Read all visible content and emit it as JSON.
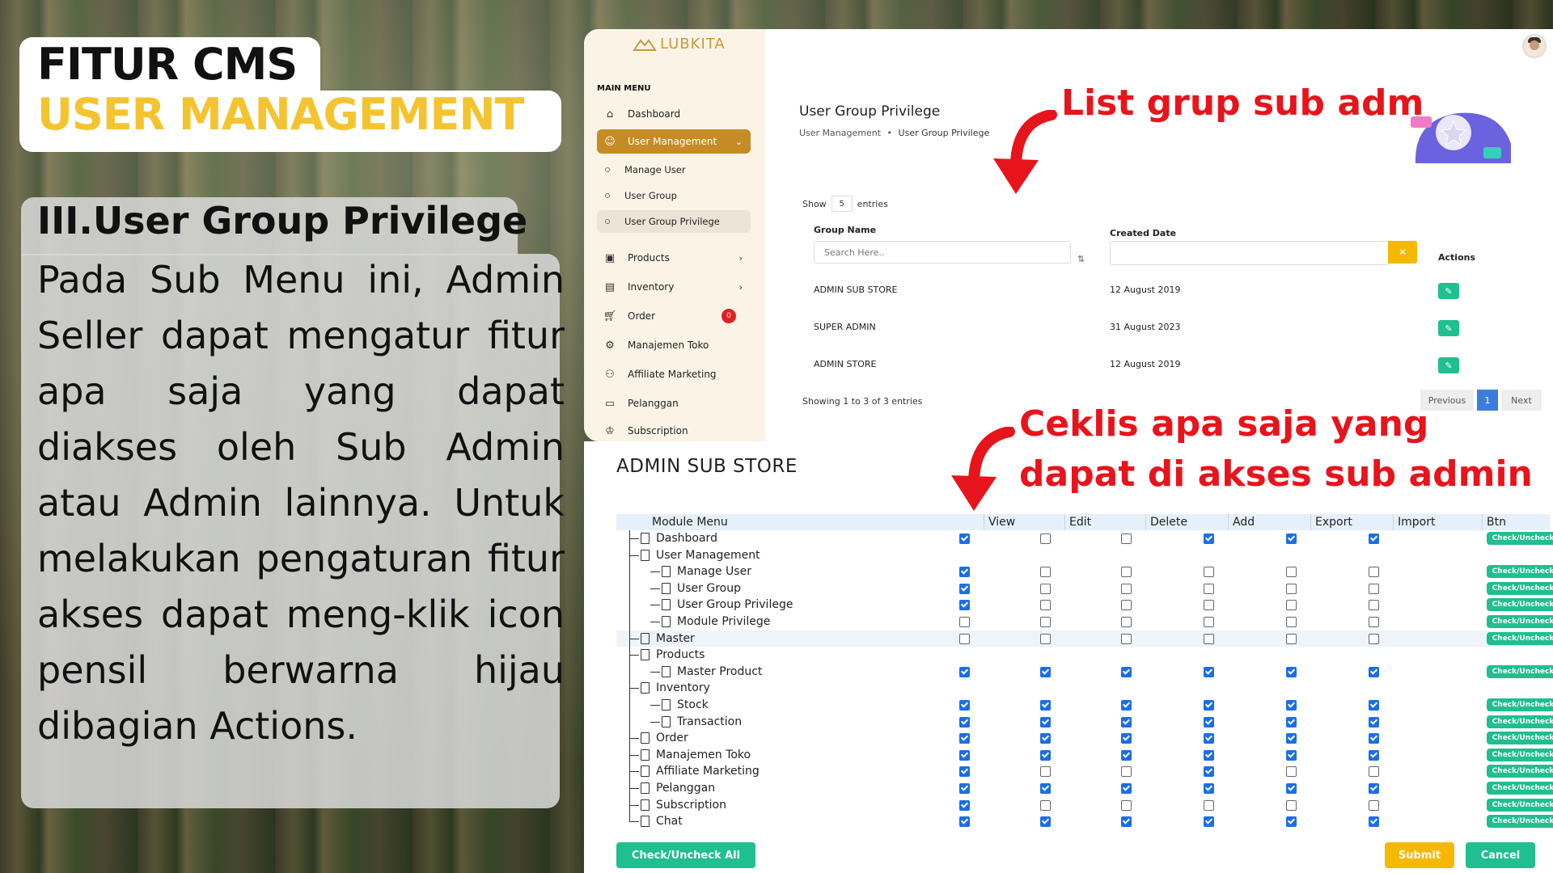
{
  "slide": {
    "title_line1": "FITUR CMS",
    "title_line2": "USER MANAGEMENT",
    "section_title": "III.User Group Privilege",
    "description": "Pada Sub Menu ini, Admin Seller dapat mengatur fitur apa saja yang dapat diakses oleh Sub Admin atau Admin lainnya. Untuk melakukan pengaturan fitur akses dapat meng-klik icon pensil berwarna hijau dibagian Actions."
  },
  "annotations": {
    "top": "List grup sub adm",
    "bottom_line1": "Ceklis apa saja yang",
    "bottom_line2": "dapat di akses sub admin"
  },
  "app": {
    "logo": "LUBKITA",
    "main_menu_label": "MAIN MENU",
    "menu": [
      {
        "label": "Dashboard",
        "icon": "home-icon"
      },
      {
        "label": "User Management",
        "icon": "user-icon",
        "active": true
      },
      {
        "label": "Products",
        "icon": "box-icon"
      },
      {
        "label": "Inventory",
        "icon": "archive-icon"
      },
      {
        "label": "Order",
        "icon": "cart-icon",
        "badge": "0"
      },
      {
        "label": "Manajemen Toko",
        "icon": "settings-icon"
      },
      {
        "label": "Affiliate Marketing",
        "icon": "users-icon"
      },
      {
        "label": "Pelanggan",
        "icon": "card-icon"
      },
      {
        "label": "Subscription",
        "icon": "crown-icon"
      }
    ],
    "submenu": [
      "Manage User",
      "User Group",
      "User Group Privilege"
    ],
    "page_title": "User Group Privilege",
    "breadcrumb": {
      "parent": "User Management",
      "separator": "•",
      "current": "User Group Privilege"
    },
    "show_label": "Show",
    "show_value": "5",
    "entries_label": "entries",
    "columns": {
      "group_name": "Group Name",
      "created_date": "Created Date",
      "actions": "Actions"
    },
    "search_placeholder": "Search Here..",
    "date_clear": "✕",
    "rows": [
      {
        "name": "ADMIN SUB STORE",
        "date": "12 August 2019"
      },
      {
        "name": "SUPER ADMIN",
        "date": "31 August 2023"
      },
      {
        "name": "ADMIN STORE",
        "date": "12 August 2019"
      }
    ],
    "showing_text": "Showing 1 to 3 of 3 entries",
    "pagination": {
      "prev": "Previous",
      "page": "1",
      "next": "Next"
    }
  },
  "privilege": {
    "title": "ADMIN SUB STORE",
    "headers": [
      "Module Menu",
      "View",
      "Edit",
      "Delete",
      "Add",
      "Export",
      "Import",
      "Btn"
    ],
    "button_label": "Check/Uncheck",
    "rows": [
      {
        "name": "Dashboard",
        "level": 0,
        "checks": [
          1,
          0,
          0,
          1,
          1,
          1
        ],
        "btn": true
      },
      {
        "name": "User Management",
        "level": 0,
        "parent": true,
        "checks": null,
        "btn": false
      },
      {
        "name": "Manage User",
        "level": 1,
        "checks": [
          1,
          0,
          0,
          0,
          0,
          0
        ],
        "btn": true
      },
      {
        "name": "User Group",
        "level": 1,
        "checks": [
          1,
          0,
          0,
          0,
          0,
          0
        ],
        "btn": true
      },
      {
        "name": "User Group Privilege",
        "level": 1,
        "checks": [
          1,
          0,
          0,
          0,
          0,
          0
        ],
        "btn": true
      },
      {
        "name": "Module Privilege",
        "level": 1,
        "checks": [
          0,
          0,
          0,
          0,
          0,
          0
        ],
        "btn": true
      },
      {
        "name": "Master",
        "level": 0,
        "checks": [
          0,
          0,
          0,
          0,
          0,
          0
        ],
        "btn": true,
        "highlight": true
      },
      {
        "name": "Products",
        "level": 0,
        "parent": true,
        "checks": null,
        "btn": false
      },
      {
        "name": "Master Product",
        "level": 1,
        "checks": [
          1,
          1,
          1,
          1,
          1,
          1
        ],
        "btn": true
      },
      {
        "name": "Inventory",
        "level": 0,
        "parent": true,
        "checks": null,
        "btn": false
      },
      {
        "name": "Stock",
        "level": 1,
        "checks": [
          1,
          1,
          1,
          1,
          1,
          1
        ],
        "btn": true
      },
      {
        "name": "Transaction",
        "level": 1,
        "checks": [
          1,
          1,
          1,
          1,
          1,
          1
        ],
        "btn": true
      },
      {
        "name": "Order",
        "level": 0,
        "checks": [
          1,
          1,
          1,
          1,
          1,
          1
        ],
        "btn": true
      },
      {
        "name": "Manajemen Toko",
        "level": 0,
        "checks": [
          1,
          1,
          1,
          1,
          1,
          1
        ],
        "btn": true
      },
      {
        "name": "Affiliate Marketing",
        "level": 0,
        "checks": [
          1,
          0,
          0,
          1,
          0,
          0
        ],
        "btn": true
      },
      {
        "name": "Pelanggan",
        "level": 0,
        "checks": [
          1,
          1,
          1,
          1,
          1,
          1
        ],
        "btn": true
      },
      {
        "name": "Subscription",
        "level": 0,
        "checks": [
          1,
          0,
          0,
          0,
          0,
          0
        ],
        "btn": true
      },
      {
        "name": "Chat",
        "level": 0,
        "checks": [
          1,
          1,
          1,
          1,
          1,
          1
        ],
        "btn": true
      }
    ],
    "check_all_label": "Check/Uncheck All",
    "submit_label": "Submit",
    "cancel_label": "Cancel"
  },
  "colors": {
    "accent_gold": "#c58b25",
    "title_yellow": "#f4c430",
    "green": "#1fbf8f",
    "red_annotation": "#e8141b",
    "submit": "#f6b800",
    "cancel": "#1fbf8f"
  }
}
